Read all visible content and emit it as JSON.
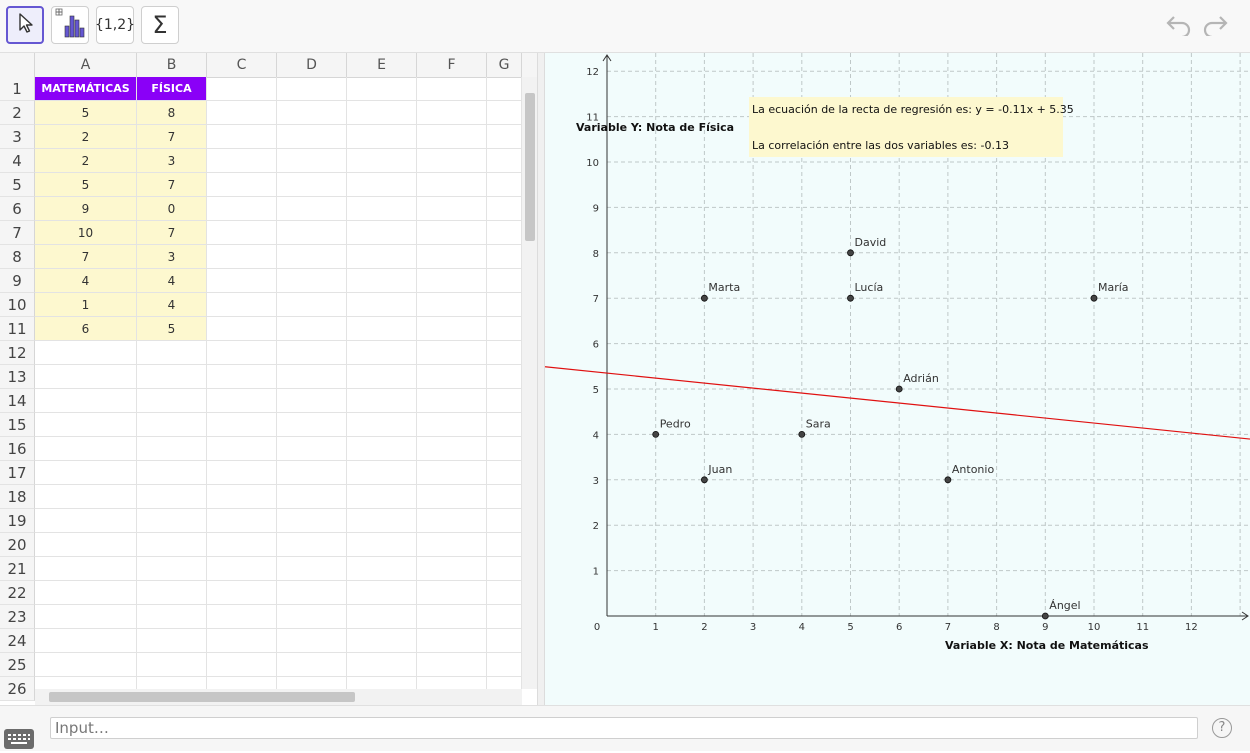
{
  "toolbar": {
    "tools": [
      {
        "name": "move-tool",
        "label": ""
      },
      {
        "name": "one-variable-analysis-tool",
        "label": ""
      },
      {
        "name": "create-list-tool",
        "label": "{1,2}"
      },
      {
        "name": "sum-tool",
        "label": "Σ"
      }
    ]
  },
  "spreadsheet": {
    "columns": [
      "A",
      "B",
      "C",
      "D",
      "E",
      "F",
      "G"
    ],
    "header_row": [
      "MATEMÁTICAS",
      "FÍSICA"
    ],
    "rows": [
      [
        "5",
        "8"
      ],
      [
        "2",
        "7"
      ],
      [
        "2",
        "3"
      ],
      [
        "5",
        "7"
      ],
      [
        "9",
        "0"
      ],
      [
        "10",
        "7"
      ],
      [
        "7",
        "3"
      ],
      [
        "4",
        "4"
      ],
      [
        "1",
        "4"
      ],
      [
        "6",
        "5"
      ]
    ],
    "row_numbers": [
      "1",
      "2",
      "3",
      "4",
      "5",
      "6",
      "7",
      "8",
      "9",
      "10",
      "11",
      "12",
      "13",
      "14",
      "15",
      "16",
      "17",
      "18",
      "19",
      "20",
      "21",
      "22",
      "23",
      "24",
      "25",
      "26"
    ],
    "header_color": "#8a00f7",
    "data_color": "#fdf8cf"
  },
  "graph": {
    "ylabel": "Variable Y: Nota de Física",
    "xlabel": "Variable X: Nota de Matemáticas",
    "regression_text": "La ecuación de la recta de regresión es:  y = -0.11x + 5.35",
    "correlation_text": "La correlación entre las dos variables es: -0.13",
    "x_ticks": [
      "0",
      "1",
      "2",
      "3",
      "4",
      "5",
      "6",
      "7",
      "8",
      "9",
      "10",
      "11",
      "12"
    ],
    "y_ticks": [
      "1",
      "2",
      "3",
      "4",
      "5",
      "6",
      "7",
      "8",
      "9",
      "10",
      "11",
      "12"
    ],
    "background": "#f2fcfc",
    "line_color": "#e01010"
  },
  "chart_data": {
    "type": "scatter",
    "xlabel": "Variable X: Nota de Matemáticas",
    "ylabel": "Variable Y: Nota de Física",
    "xlim": [
      0,
      13
    ],
    "ylim": [
      0,
      12
    ],
    "grid": true,
    "points": [
      {
        "label": "David",
        "x": 5,
        "y": 8
      },
      {
        "label": "Marta",
        "x": 2,
        "y": 7
      },
      {
        "label": "Juan",
        "x": 2,
        "y": 3
      },
      {
        "label": "Lucía",
        "x": 5,
        "y": 7
      },
      {
        "label": "Ángel",
        "x": 9,
        "y": 0
      },
      {
        "label": "María",
        "x": 10,
        "y": 7
      },
      {
        "label": "Antonio",
        "x": 7,
        "y": 3
      },
      {
        "label": "Sara",
        "x": 4,
        "y": 4
      },
      {
        "label": "Pedro",
        "x": 1,
        "y": 4
      },
      {
        "label": "Adrián",
        "x": 6,
        "y": 5
      }
    ],
    "regression": {
      "slope": -0.11,
      "intercept": 5.35
    }
  },
  "input_bar": {
    "placeholder": "Input…",
    "help_label": "?"
  }
}
